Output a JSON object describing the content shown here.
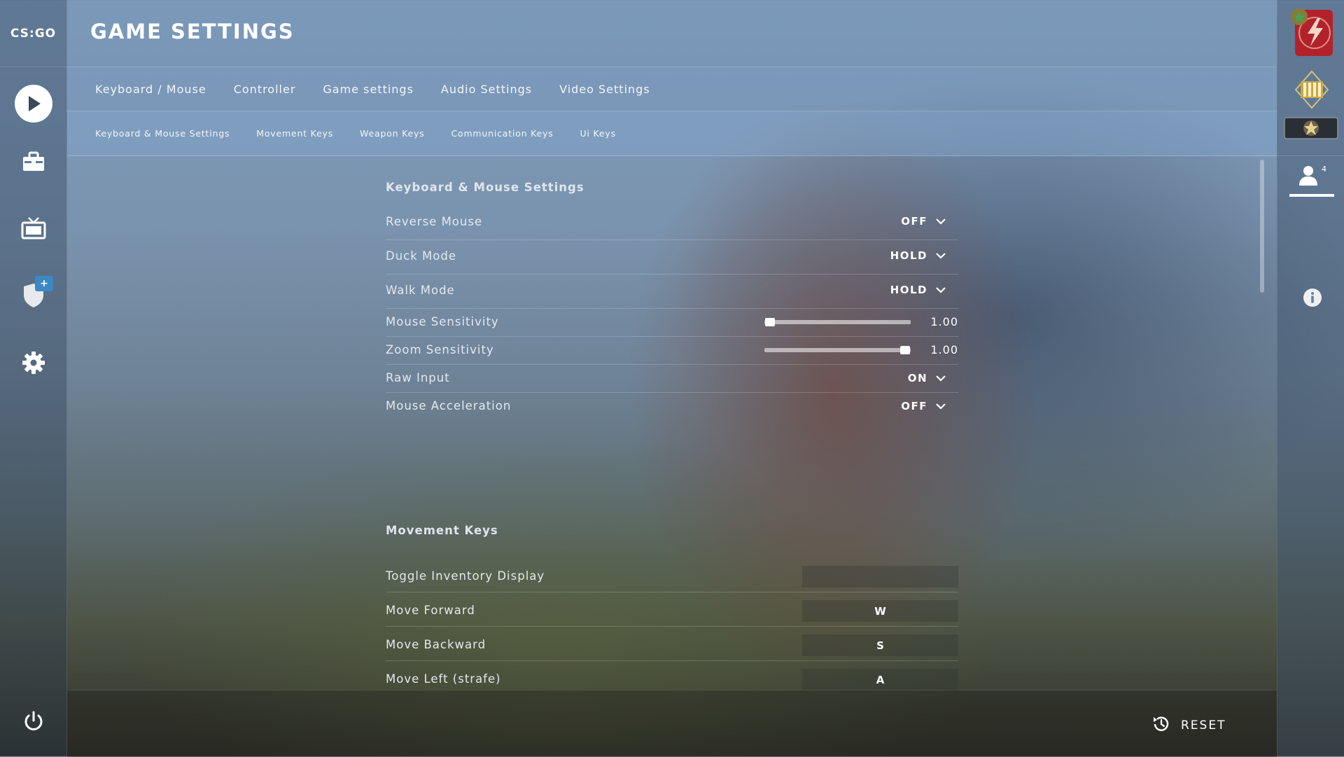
{
  "app": {
    "logo_text": "CS:GO"
  },
  "header": {
    "title": "GAME SETTINGS"
  },
  "tabs": [
    "Keyboard / Mouse",
    "Controller",
    "Game settings",
    "Audio Settings",
    "Video Settings"
  ],
  "subtabs": [
    "Keyboard & Mouse Settings",
    "Movement Keys",
    "Weapon Keys",
    "Communication Keys",
    "Ui Keys"
  ],
  "sections": {
    "mouse": {
      "title": "Keyboard & Mouse Settings",
      "reverse_mouse": {
        "label": "Reverse Mouse",
        "value": "OFF"
      },
      "duck_mode": {
        "label": "Duck Mode",
        "value": "HOLD"
      },
      "walk_mode": {
        "label": "Walk Mode",
        "value": "HOLD"
      },
      "mouse_sensitivity": {
        "label": "Mouse Sensitivity",
        "value": "1.00",
        "slider_fraction": 0.04
      },
      "zoom_sensitivity": {
        "label": "Zoom Sensitivity",
        "value": "1.00",
        "slider_fraction": 0.96
      },
      "raw_input": {
        "label": "Raw Input",
        "value": "ON"
      },
      "mouse_acceleration": {
        "label": "Mouse Acceleration",
        "value": "OFF"
      }
    },
    "movement": {
      "title": "Movement Keys",
      "toggle_inventory": {
        "label": "Toggle Inventory Display",
        "key": ""
      },
      "move_forward": {
        "label": "Move Forward",
        "key": "W"
      },
      "move_backward": {
        "label": "Move Backward",
        "key": "S"
      },
      "move_left": {
        "label": "Move Left (strafe)",
        "key": "A"
      }
    }
  },
  "right_panel": {
    "friends_count": "4"
  },
  "footer": {
    "reset_label": "RESET"
  },
  "colors": {
    "accent": "#3b88c4",
    "text": "#ffffff",
    "rank_red": "#b3222a"
  },
  "icons": [
    "play-icon",
    "inventory-icon",
    "watch-icon",
    "shield-icon",
    "gear-icon",
    "power-icon",
    "info-icon",
    "friends-icon",
    "reset-icon",
    "chevron-down-icon"
  ]
}
